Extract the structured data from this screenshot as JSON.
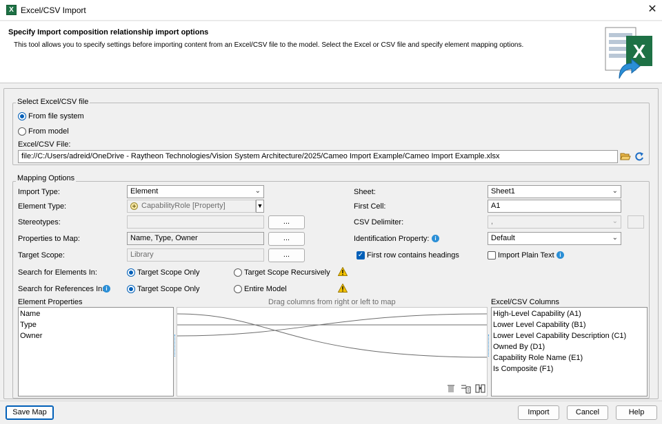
{
  "window": {
    "title": "Excel/CSV Import",
    "close_glyph": "✕"
  },
  "header": {
    "title": "Specify Import composition relationship import options",
    "description": "This tool allows you to specify settings before importing content from an Excel/CSV file to the model. Select the Excel or CSV file and specify element mapping options.",
    "logo_letter": "X"
  },
  "select_file": {
    "legend": "Select Excel/CSV file",
    "from_file_system": "From file system",
    "from_model": "From model",
    "file_label": "Excel/CSV File:",
    "file_path": "file://C:/Users/adreid/OneDrive - Raytheon Technologies/Vision System Architecture/2025/Cameo Import Example/Cameo Import Example.xlsx"
  },
  "mapping": {
    "legend": "Mapping Options",
    "import_type_label": "Import Type:",
    "import_type_value": "Element",
    "element_type_label": "Element Type:",
    "element_type_value": "CapabilityRole [Property]",
    "stereotypes_label": "Stereotypes:",
    "stereotypes_value": "",
    "properties_label": "Properties to Map:",
    "properties_value": "Name, Type, Owner",
    "target_scope_label": "Target Scope:",
    "target_scope_value": "Library",
    "ellipsis": "...",
    "search_elements_label": "Search for Elements In:",
    "search_references_label": "Search for References In:",
    "target_scope_only": "Target Scope Only",
    "target_scope_recursively": "Target Scope Recursively",
    "entire_model": "Entire Model",
    "sheet_label": "Sheet:",
    "sheet_value": "Sheet1",
    "first_cell_label": "First Cell:",
    "first_cell_value": "A1",
    "csv_delimiter_label": "CSV Delimiter:",
    "csv_delimiter_value": ",",
    "identification_label": "Identification Property:",
    "identification_value": "Default",
    "first_row_headings": "First row contains headings",
    "import_plain_text": "Import Plain Text",
    "element_properties_label": "Element Properties",
    "element_properties": [
      "Name",
      "Type",
      "Owner"
    ],
    "drag_hint": "Drag columns from right or left to map",
    "excel_columns_label": "Excel/CSV Columns",
    "excel_columns": [
      "High-Level Capability (A1)",
      "Lower Level Capability (B1)",
      "Lower Level Capability Description (C1)",
      "Owned By (D1)",
      "Capability Role Name (E1)",
      "Is Composite (F1)"
    ]
  },
  "buttons": {
    "save_map": "Save Map",
    "import": "Import",
    "cancel": "Cancel",
    "help": "Help"
  },
  "colors": {
    "accent": "#005fb8",
    "excel_green": "#1e7145",
    "warning": "#f5c400",
    "info": "#2b8fd6"
  }
}
